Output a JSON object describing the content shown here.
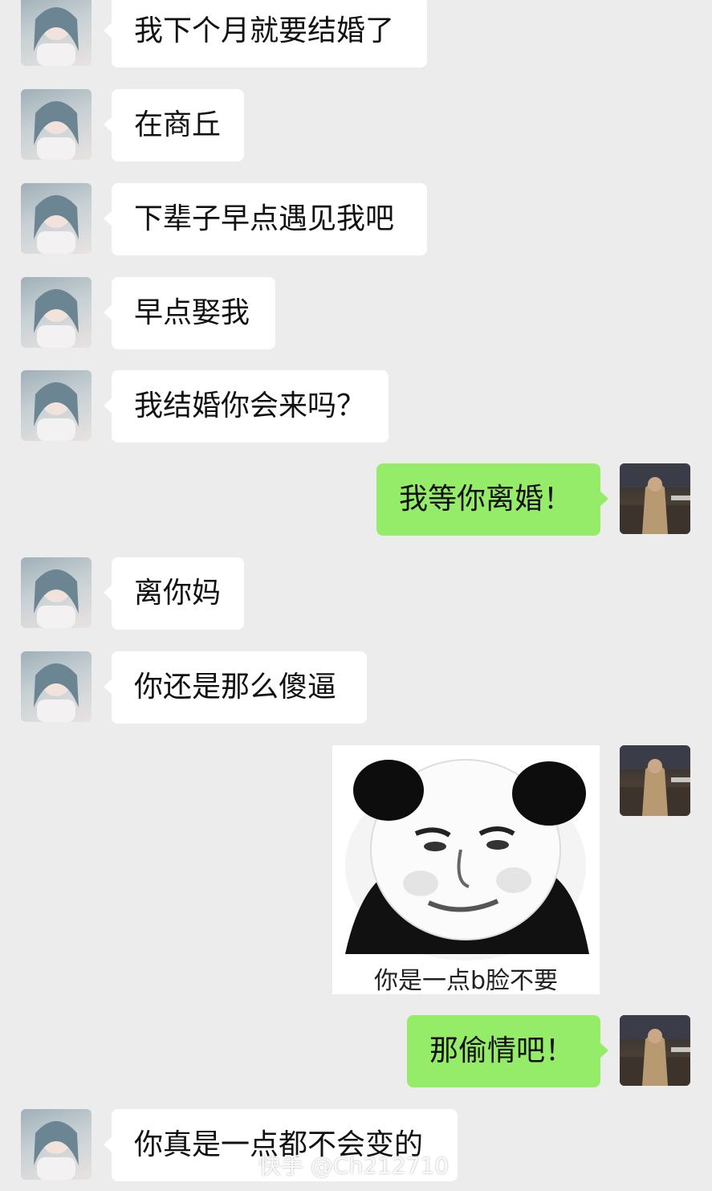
{
  "messages": [
    {
      "side": "left",
      "text": "我下个月就要结婚了"
    },
    {
      "side": "left",
      "text": "在商丘"
    },
    {
      "side": "left",
      "text": "下辈子早点遇见我吧"
    },
    {
      "side": "left",
      "text": "早点娶我"
    },
    {
      "side": "left",
      "text": "我结婚你会来吗？"
    },
    {
      "side": "right",
      "text": "我等你离婚！"
    },
    {
      "side": "left",
      "text": "离你妈"
    },
    {
      "side": "left",
      "text": "你还是那么傻逼"
    },
    {
      "side": "right",
      "type": "sticker",
      "caption": "你是一点b脸不要"
    },
    {
      "side": "right",
      "text": "那偷情吧！"
    },
    {
      "side": "left",
      "text": "你真是一点都不会变的"
    }
  ],
  "watermark": "快手 @Ch212710",
  "colors": {
    "background": "#ececec",
    "bubble_left": "#ffffff",
    "bubble_right": "#95ec69"
  }
}
